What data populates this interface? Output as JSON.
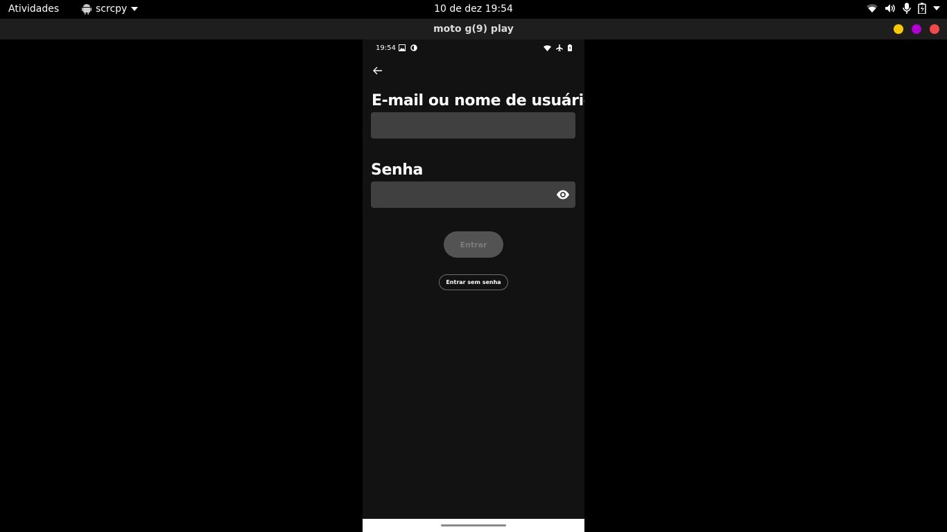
{
  "topbar": {
    "activities": "Atividades",
    "app_name": "scrcpy",
    "clock": "10 de dez  19:54"
  },
  "window": {
    "title": "moto g(9) play",
    "buttons": {
      "minimize_color": "#f8c800",
      "maximize_color": "#b000d0",
      "close_color": "#f04a4a"
    }
  },
  "phone": {
    "status_time": "19:54",
    "email_label": "E-mail ou nome de usuário",
    "email_value": "",
    "password_label": "Senha",
    "password_value": "",
    "login_button": "Entrar",
    "passwordless_button": "Entrar sem senha"
  },
  "icons": [
    "android-icon",
    "chevron-down-icon",
    "wifi-icon",
    "volume-icon",
    "microphone-icon",
    "battery-icon",
    "image-icon",
    "data-saver-icon",
    "airplane-icon",
    "back-arrow-icon",
    "eye-icon"
  ],
  "colors": {
    "screen_bg": "#121212",
    "input_bg": "#404040",
    "button_disabled": "#535353"
  }
}
